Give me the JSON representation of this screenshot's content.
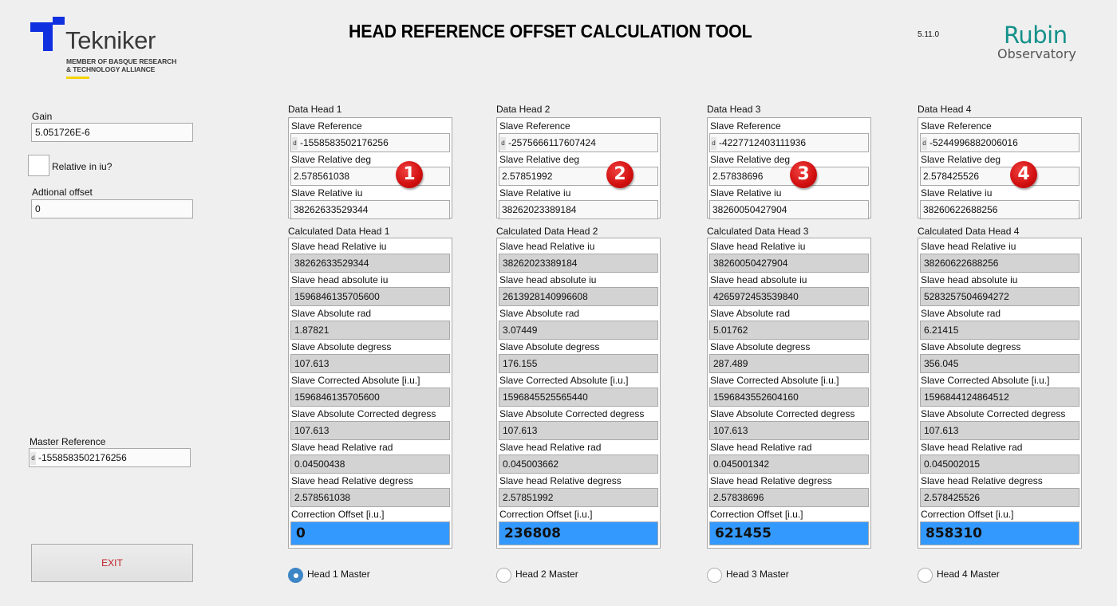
{
  "header": {
    "title": "HEAD REFERENCE OFFSET CALCULATION TOOL",
    "version": "5.11.0",
    "logo_left": {
      "name": "Tekniker",
      "subtitle_line1": "MEMBER OF BASQUE RESEARCH",
      "subtitle_line2": "& TECHNOLOGY ALLIANCE",
      "brand_color": "#1030e0",
      "accent_color": "#f5d300"
    },
    "logo_right": {
      "line1": "Rubin",
      "line2": "Observatory",
      "brand_color": "#14918a"
    }
  },
  "left_panel": {
    "gain_label": "Gain",
    "gain_value": "5.051726E-6",
    "relative_in_iu_label": "Relative in iu?",
    "relative_in_iu_checked": false,
    "additional_offset_label": "Adtional offset",
    "additional_offset_value": "0",
    "master_reference_label": "Master Reference",
    "master_reference_prefix": "d",
    "master_reference_value": "-1558583502176256",
    "exit_label": "EXIT",
    "exit_color": "#c0202a"
  },
  "heads": [
    {
      "data_title": "Data Head 1",
      "badge": "1",
      "inputs": {
        "slave_reference_label": "Slave Reference",
        "slave_reference_prefix": "d",
        "slave_reference_value": "-1558583502176256",
        "slave_relative_deg_label": "Slave Relative deg",
        "slave_relative_deg_value": "2.578561038",
        "slave_relative_iu_label": "Slave Relative iu",
        "slave_relative_iu_value": "38262633529344"
      },
      "calc_title": "Calculated Data Head 1",
      "calc": [
        {
          "label": "Slave head Relative iu",
          "value": "38262633529344"
        },
        {
          "label": "Slave head absolute iu",
          "value": "1596846135705600"
        },
        {
          "label": "Slave Absolute rad",
          "value": "1.87821"
        },
        {
          "label": "Slave Absolute degress",
          "value": "107.613"
        },
        {
          "label": "Slave Corrected Absolute [i.u.]",
          "value": "1596846135705600"
        },
        {
          "label": "Slave Absolute Corrected degress",
          "value": "107.613"
        },
        {
          "label": "Slave head Relative rad",
          "value": "0.04500438"
        },
        {
          "label": "Slave head Relative degress",
          "value": "2.578561038"
        }
      ],
      "correction_label": "Correction Offset [i.u.]",
      "correction_value": "0",
      "master_label": "Head 1 Master",
      "master_selected": true
    },
    {
      "data_title": "Data Head 2",
      "badge": "2",
      "inputs": {
        "slave_reference_label": "Slave Reference",
        "slave_reference_prefix": "d",
        "slave_reference_value": "-2575666117607424",
        "slave_relative_deg_label": "Slave Relative deg",
        "slave_relative_deg_value": "2.57851992",
        "slave_relative_iu_label": "Slave Relative iu",
        "slave_relative_iu_value": "38262023389184"
      },
      "calc_title": "Calculated Data Head 2",
      "calc": [
        {
          "label": "Slave head Relative iu",
          "value": "38262023389184"
        },
        {
          "label": "Slave head absolute iu",
          "value": "2613928140996608"
        },
        {
          "label": "Slave Absolute rad",
          "value": "3.07449"
        },
        {
          "label": "Slave Absolute degress",
          "value": "176.155"
        },
        {
          "label": "Slave Corrected Absolute [i.u.]",
          "value": "1596845525565440"
        },
        {
          "label": "Slave Absolute Corrected degress",
          "value": "107.613"
        },
        {
          "label": "Slave head Relative rad",
          "value": "0.045003662"
        },
        {
          "label": "Slave head Relative degress",
          "value": "2.57851992"
        }
      ],
      "correction_label": "Correction Offset [i.u.]",
      "correction_value": "236808",
      "master_label": "Head 2 Master",
      "master_selected": false
    },
    {
      "data_title": "Data Head 3",
      "badge": "3",
      "inputs": {
        "slave_reference_label": "Slave Reference",
        "slave_reference_prefix": "d",
        "slave_reference_value": "-4227712403111936",
        "slave_relative_deg_label": "Slave Relative deg",
        "slave_relative_deg_value": "2.57838696",
        "slave_relative_iu_label": "Slave Relative iu",
        "slave_relative_iu_value": "38260050427904"
      },
      "calc_title": "Calculated Data Head 3",
      "calc": [
        {
          "label": "Slave head Relative iu",
          "value": "38260050427904"
        },
        {
          "label": "Slave head absolute iu",
          "value": "4265972453539840"
        },
        {
          "label": "Slave Absolute rad",
          "value": "5.01762"
        },
        {
          "label": "Slave Absolute degress",
          "value": "287.489"
        },
        {
          "label": "Slave Corrected Absolute [i.u.]",
          "value": "1596843552604160"
        },
        {
          "label": "Slave Absolute Corrected degress",
          "value": "107.613"
        },
        {
          "label": "Slave head Relative rad",
          "value": "0.045001342"
        },
        {
          "label": "Slave head Relative degress",
          "value": "2.57838696"
        }
      ],
      "correction_label": "Correction Offset [i.u.]",
      "correction_value": "621455",
      "master_label": "Head 3 Master",
      "master_selected": false
    },
    {
      "data_title": "Data Head 4",
      "badge": "4",
      "inputs": {
        "slave_reference_label": "Slave Reference",
        "slave_reference_prefix": "d",
        "slave_reference_value": "-5244996882006016",
        "slave_relative_deg_label": "Slave Relative deg",
        "slave_relative_deg_value": "2.578425526",
        "slave_relative_iu_label": "Slave Relative iu",
        "slave_relative_iu_value": "38260622688256"
      },
      "calc_title": "Calculated Data Head 4",
      "calc": [
        {
          "label": "Slave head Relative iu",
          "value": "38260622688256"
        },
        {
          "label": "Slave head absolute iu",
          "value": "5283257504694272"
        },
        {
          "label": "Slave Absolute rad",
          "value": "6.21415"
        },
        {
          "label": "Slave Absolute degress",
          "value": "356.045"
        },
        {
          "label": "Slave Corrected Absolute [i.u.]",
          "value": "1596844124864512"
        },
        {
          "label": "Slave Absolute Corrected degress",
          "value": "107.613"
        },
        {
          "label": "Slave head Relative rad",
          "value": "0.045002015"
        },
        {
          "label": "Slave head Relative degress",
          "value": "2.578425526"
        }
      ],
      "correction_label": "Correction Offset [i.u.]",
      "correction_value": "858310",
      "master_label": "Head 4 Master",
      "master_selected": false
    }
  ],
  "colors": {
    "correction_highlight": "#3399ff",
    "output_field_bg": "#d3d3d3",
    "radio_selected": "#3d86c6",
    "badge_red": "#d10f0f"
  }
}
